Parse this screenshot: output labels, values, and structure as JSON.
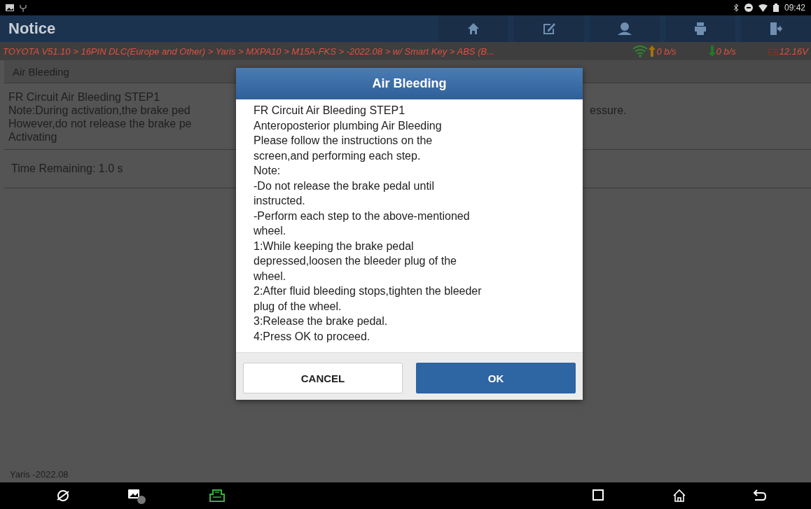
{
  "status_bar": {
    "time": "09:42"
  },
  "header": {
    "title": "Notice"
  },
  "breadcrumb": {
    "path": "TOYOTA V51.10 > 16PIN DLC(Europe and Other) > Yaris > MXPA10 > M15A-FKS > -2022.08 > w/ Smart Key > ABS (B...",
    "upload": "0 b/s",
    "download": "0 b/s",
    "voltage": "12.16V"
  },
  "section_title": "Air Bleeding",
  "info": {
    "lines_left": [
      "FR Circuit Air Bleeding STEP1",
      "Note:During activation,the brake ped",
      "However,do not release the brake pe",
      "Activating"
    ],
    "line_right": "essure."
  },
  "time_remaining": "Time Remaining: 1.0 s",
  "footer": "Yaris -2022.08",
  "dialog": {
    "title": "Air Bleeding",
    "lines": [
      "FR Circuit Air Bleeding STEP1",
      "Anteroposterior plumbing Air Bleeding",
      "Please follow the instructions on the",
      "screen,and performing each step.",
      "Note:",
      "-Do not release the brake pedal until",
      "instructed.",
      "-Perform each step to the above-mentioned",
      "wheel.",
      "1:While keeping the brake pedal",
      "depressed,loosen the bleeder plug of the",
      "wheel.",
      "2:After fluid bleeding stops,tighten the bleeder",
      "plug of the wheel.",
      "3:Release the brake pedal.",
      "4:Press OK to proceed."
    ],
    "buttons": [
      {
        "label": "CANCEL",
        "kind": "secondary"
      },
      {
        "label": "OK",
        "kind": "primary"
      }
    ]
  }
}
